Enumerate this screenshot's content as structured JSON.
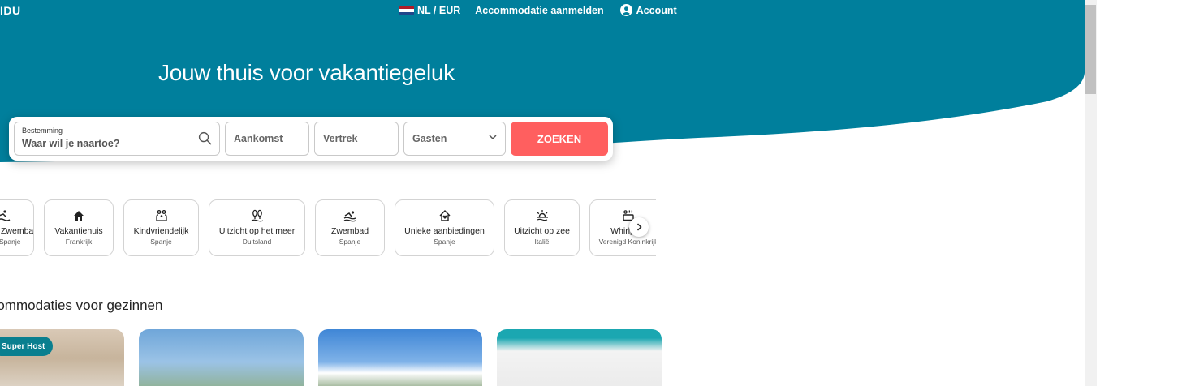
{
  "header": {
    "logo": "IDU",
    "language": "NL / EUR",
    "list_property": "Accommodatie aanmelden",
    "account": "Account"
  },
  "hero": {
    "title": "Jouw thuis voor vakantiegeluk"
  },
  "search": {
    "destination_label": "Bestemming",
    "destination_placeholder": "Waar wil je naartoe?",
    "arrival": "Aankomst",
    "departure": "Vertrek",
    "guests": "Gasten",
    "button": "ZOEKEN"
  },
  "categories": [
    {
      "title": "Zwembad",
      "subtitle": "Spanje",
      "icon": "pool-icon"
    },
    {
      "title": "Vakantiehuis",
      "subtitle": "Frankrijk",
      "icon": "house-icon"
    },
    {
      "title": "Kindvriendelijk",
      "subtitle": "Spanje",
      "icon": "family-icon"
    },
    {
      "title": "Uitzicht op het meer",
      "subtitle": "Duitsland",
      "icon": "lake-view-icon"
    },
    {
      "title": "Zwembad",
      "subtitle": "Spanje",
      "icon": "swimmer-icon"
    },
    {
      "title": "Unieke aanbiedingen",
      "subtitle": "Spanje",
      "icon": "home-heart-icon"
    },
    {
      "title": "Uitzicht op zee",
      "subtitle": "Italië",
      "icon": "sunset-icon"
    },
    {
      "title": "Whirlpool",
      "subtitle": "Verenigd Koninkrijk",
      "icon": "hot-tub-icon"
    }
  ],
  "section": {
    "title": "Accommodaties voor gezinnen"
  },
  "cards": {
    "badge": "Super Host"
  },
  "colors": {
    "brand": "#007f9c",
    "cta": "#ff5f5f"
  }
}
